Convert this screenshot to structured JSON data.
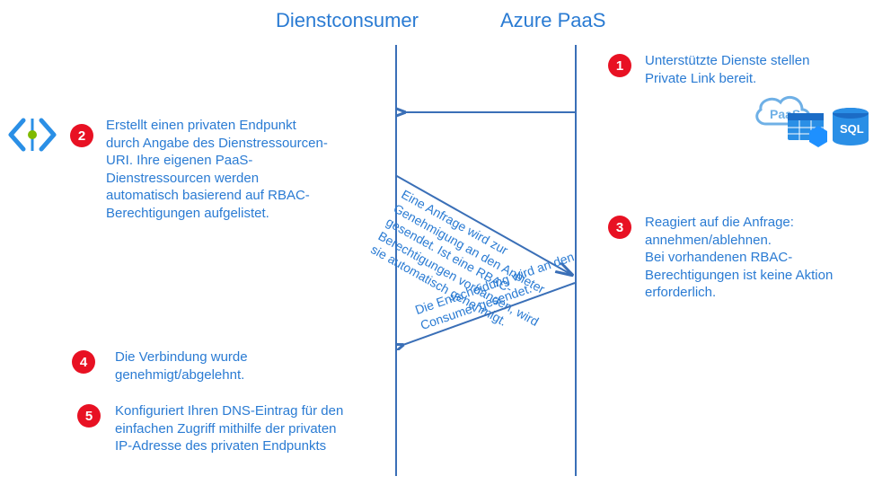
{
  "columns": {
    "consumer_title": "Dienstconsumer",
    "provider_title": "Azure PaaS"
  },
  "steps": {
    "s1": {
      "num": "1",
      "text": "Unterstützte Dienste stellen Private Link bereit."
    },
    "s2": {
      "num": "2",
      "text": "Erstellt einen privaten Endpunkt durch Angabe des Dienstressourcen-URI. Ihre eigenen PaaS-Dienstressourcen werden automatisch basierend auf RBAC-Berechtigungen aufgelistet."
    },
    "s3": {
      "num": "3",
      "text": "Reagiert auf die Anfrage: annehmen/ablehnen.\nBei vorhandenen RBAC-Berechtigungen ist keine Aktion erforderlich."
    },
    "s4": {
      "num": "4",
      "text": "Die Verbindung wurde genehmigt/abgelehnt."
    },
    "s5": {
      "num": "5",
      "text": "Konfiguriert Ihren DNS-Eintrag für den einfachen Zugriff mithilfe der privaten IP-Adresse des privaten Endpunkts"
    }
  },
  "messages": {
    "m2": "",
    "m1": "Eine Anfrage wird zur Genehmigung an den Anbieter gesendet. Ist eine RBAC-Berechtigungen vorhanden, wird sie automatisch genehmigt.",
    "m3": "Die Entscheidung wird an den Consumer gesendet."
  },
  "icons": {
    "code_icon_name": "code-endpoint-icon",
    "paas_cloud_label": "PaaS",
    "sql_label": "SQL"
  },
  "colors": {
    "azure_blue": "#2a7bd3",
    "line_blue": "#3a6fb7",
    "badge_red": "#e81123"
  }
}
